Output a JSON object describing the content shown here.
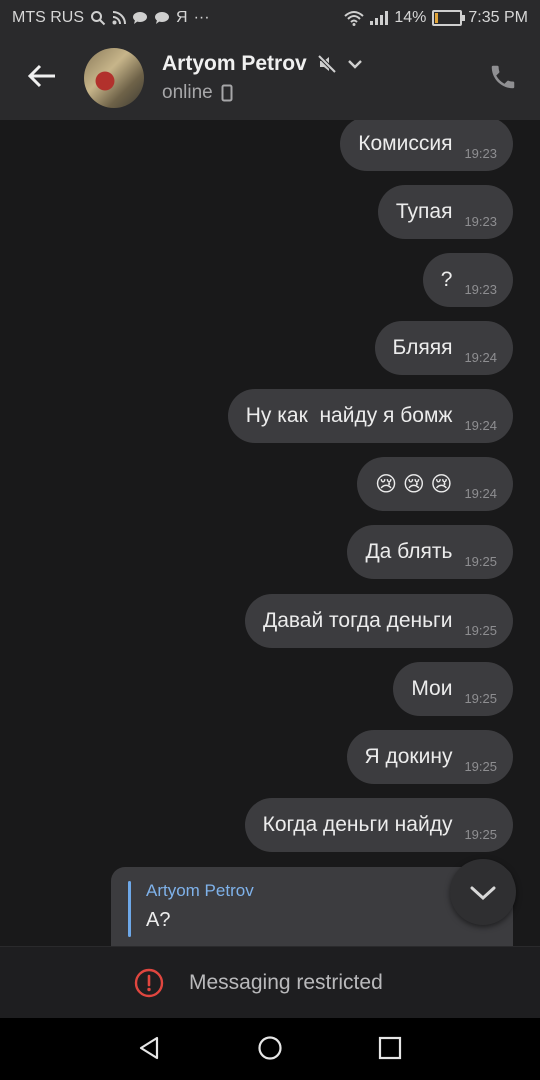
{
  "status_bar": {
    "carrier": "MTS RUS",
    "carrier_extra": "Я",
    "more": "···",
    "battery_percent": "14%",
    "battery_level": 0.14,
    "time": "7:35 PM",
    "icons_left": [
      "search-icon",
      "rss-icon",
      "chat-bubble-icon",
      "chat-bubble-icon"
    ],
    "icons_right": [
      "wifi-icon",
      "signal-icon",
      "battery-icon"
    ]
  },
  "header": {
    "contact_name": "Artyom Petrov",
    "status": "online",
    "icons": [
      "back-arrow-icon",
      "muted-icon",
      "chevron-down-icon",
      "mobile-device-icon",
      "phone-icon"
    ]
  },
  "messages": [
    {
      "text": "Комиссия",
      "time": "19:23"
    },
    {
      "text": "Тупая",
      "time": "19:23"
    },
    {
      "text": "?",
      "time": "19:23"
    },
    {
      "text": "Бляяя",
      "time": "19:24"
    },
    {
      "text": "Ну как  найду я бомж",
      "time": "19:24"
    },
    {
      "text": "😢 😢 😢",
      "time": "19:24"
    },
    {
      "text": "Да блять",
      "time": "19:25"
    },
    {
      "text": "Давай тогда деньги",
      "time": "19:25"
    },
    {
      "text": "Мои",
      "time": "19:25"
    },
    {
      "text": "Я докину",
      "time": "19:25"
    },
    {
      "text": "Когда деньги найду",
      "time": "19:25"
    }
  ],
  "reply": {
    "author": "Artyom Petrov",
    "text": "А?"
  },
  "footer": {
    "restricted_label": "Messaging restricted",
    "icon": "alert-circle-icon",
    "accent_color": "#e0463f"
  },
  "nav": {
    "icons": [
      "nav-back-icon",
      "nav-home-icon",
      "nav-recents-icon"
    ]
  }
}
